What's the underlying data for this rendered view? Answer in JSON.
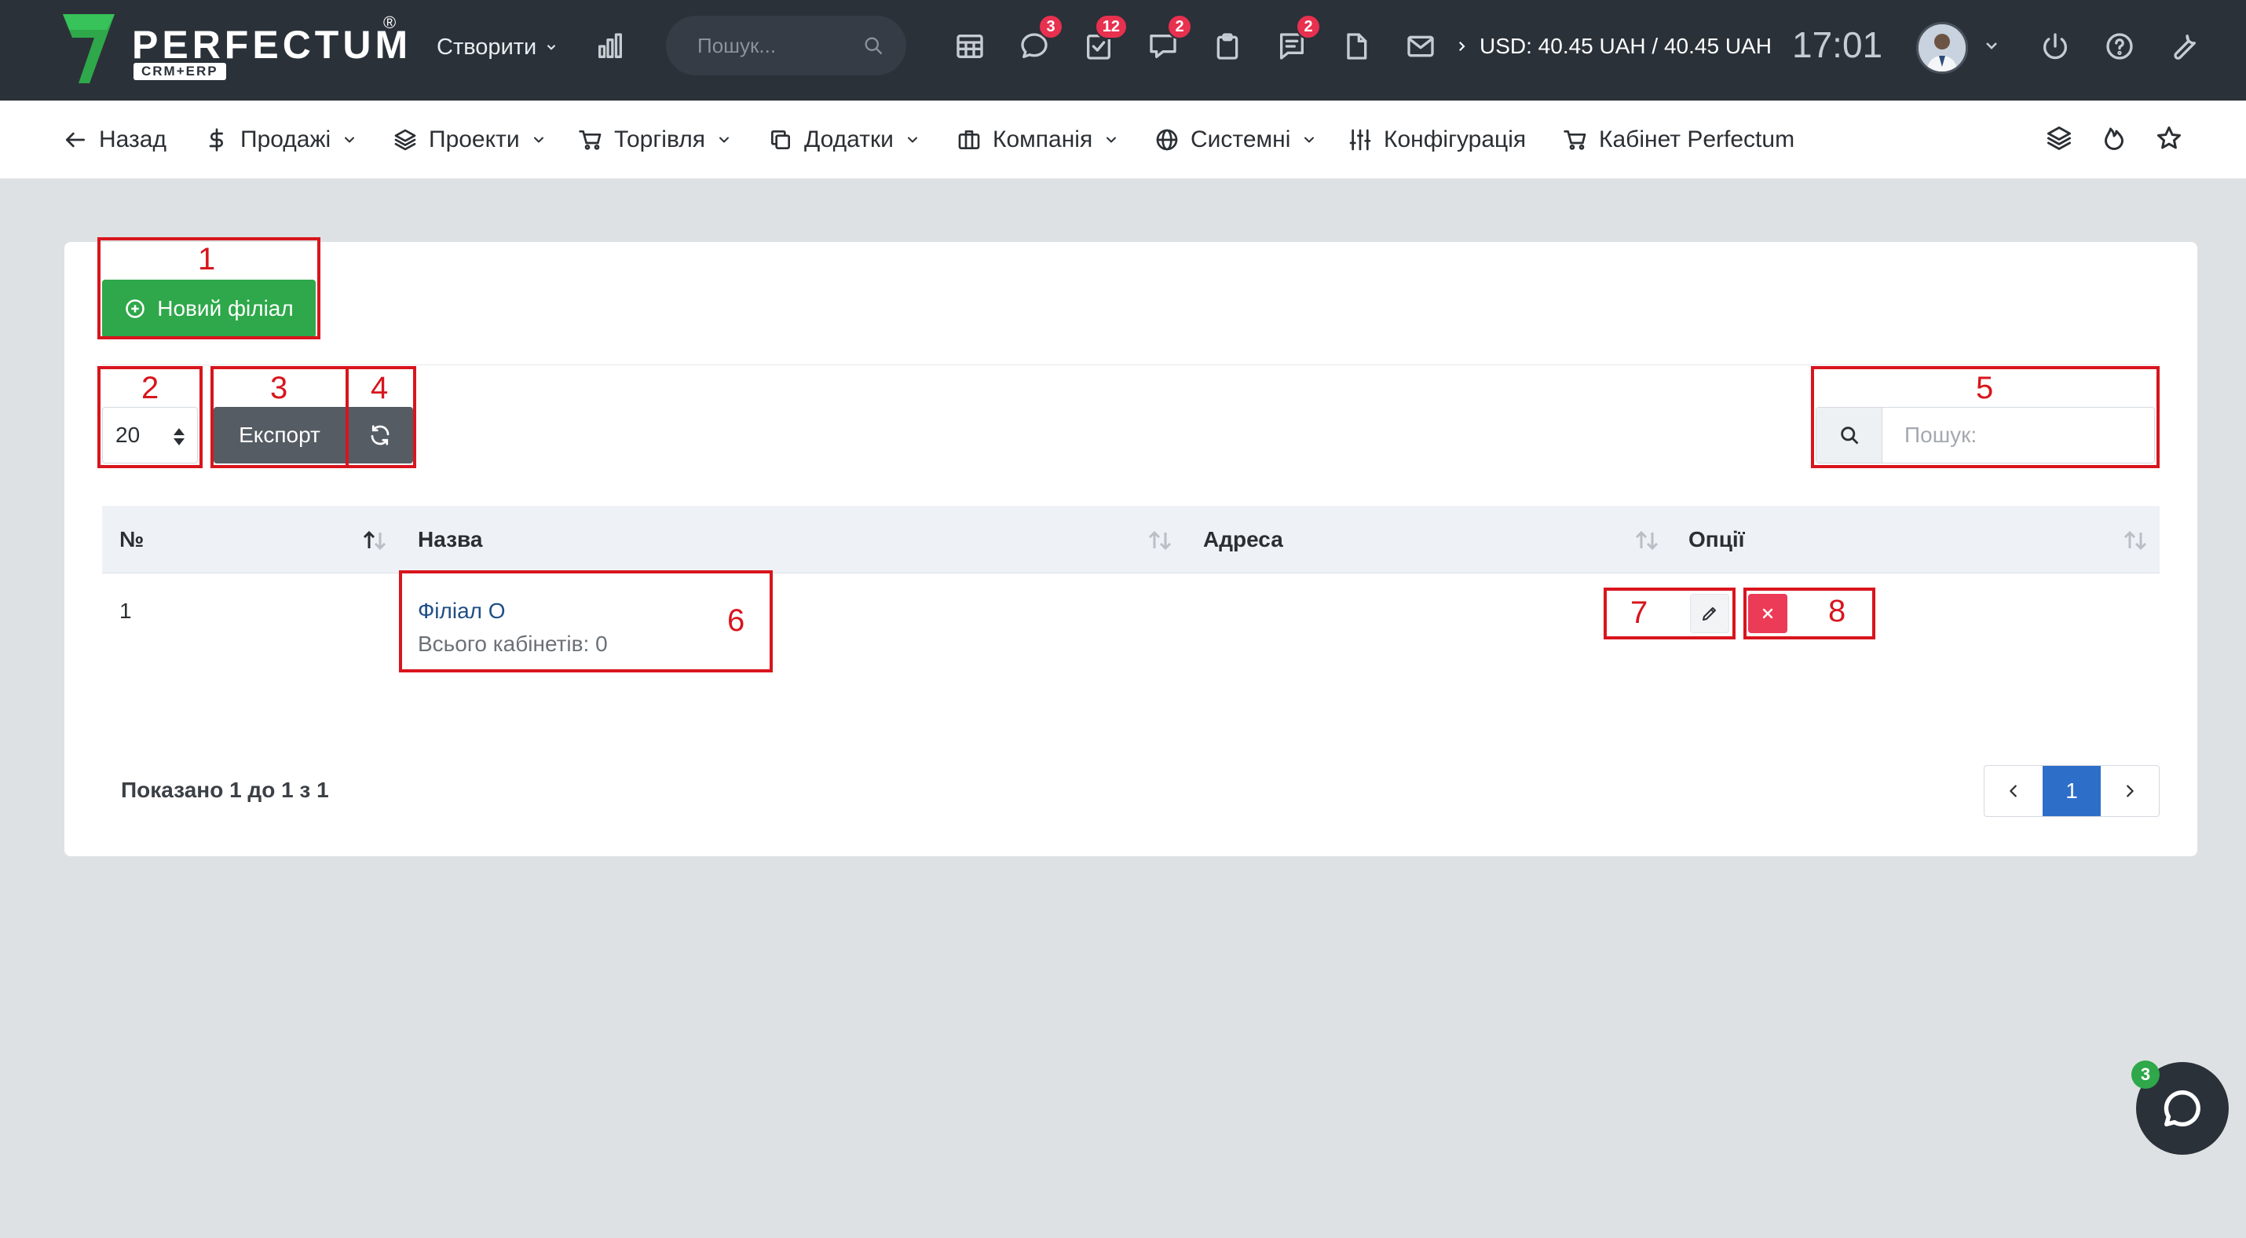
{
  "header": {
    "logo_text": "PERFECTUM",
    "logo_reg": "®",
    "logo_sub": "CRM+ERP",
    "create_label": "Створити",
    "search_placeholder": "Пошук...",
    "badges": {
      "messages": "3",
      "tasks": "12",
      "chat": "2",
      "notes": "2"
    },
    "currency_text": "USD: 40.45 UAH / 40.45 UAH",
    "time": "17:01"
  },
  "nav": {
    "back": "Назад",
    "sales": "Продажі",
    "projects": "Проекти",
    "trade": "Торгівля",
    "addons": "Додатки",
    "company": "Компанія",
    "system": "Системні",
    "config": "Конфігурація",
    "cabinet": "Кабінет Perfectum"
  },
  "toolbar": {
    "new_branch": "Новий філіал",
    "page_size": "20",
    "export": "Експорт",
    "search_placeholder": "Пошук:"
  },
  "table": {
    "columns": [
      "№",
      "Назва",
      "Адреса",
      "Опції"
    ],
    "rows": [
      {
        "num": "1",
        "name": "Філіал О",
        "sub": "Всього кабінетів: 0",
        "address": ""
      }
    ]
  },
  "footer": {
    "info": "Показано 1 до 1 з 1",
    "current_page": "1"
  },
  "annotations": [
    "1",
    "2",
    "3",
    "4",
    "5",
    "6",
    "7",
    "8"
  ],
  "chat_badge": "3",
  "colors": {
    "topbar": "#2b3139",
    "primary_green": "#2ea84a",
    "danger": "#ec3b57",
    "badge": "#e8304f",
    "annotation": "#d8151d",
    "link": "#1f4e86",
    "active_page": "#2d6ec9"
  },
  "icons": {
    "top": [
      "analytics-icon",
      "calendar-icon",
      "message-icon",
      "task-check-icon",
      "chat-icon",
      "clipboard-icon",
      "notes-icon",
      "file-icon",
      "mail-icon"
    ],
    "nav_right": [
      "layers-icon",
      "fire-icon",
      "star-icon"
    ]
  }
}
